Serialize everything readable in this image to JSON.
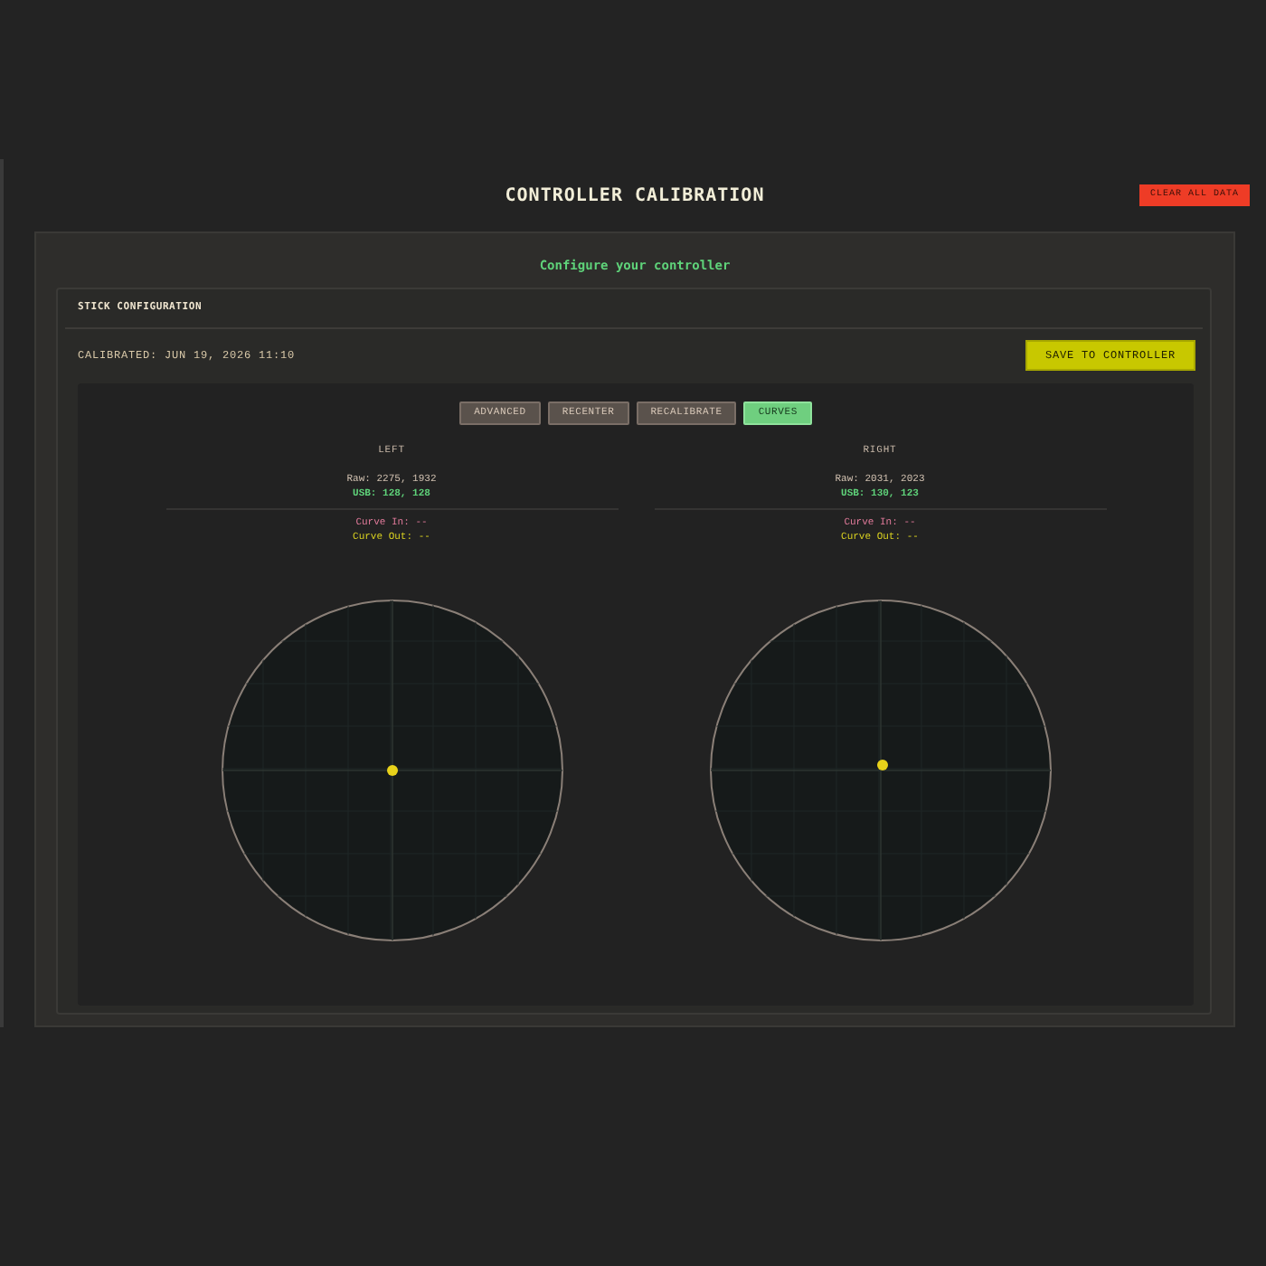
{
  "header": {
    "title": "CONTROLLER CALIBRATION",
    "clear_button": "CLEAR ALL DATA"
  },
  "card": {
    "subtitle": "Configure your controller"
  },
  "stick_panel": {
    "title": "STICK CONFIGURATION",
    "calibrated": "CALIBRATED: JUN 19, 2026 11:10",
    "save_button": "SAVE TO CONTROLLER",
    "tabs": [
      {
        "label": "ADVANCED",
        "selected": false
      },
      {
        "label": "RECENTER",
        "selected": false
      },
      {
        "label": "RECALIBRATE",
        "selected": false
      },
      {
        "label": "CURVES",
        "selected": true
      }
    ],
    "sticks": [
      {
        "label": "LEFT",
        "raw": "Raw: 2275, 1932",
        "usb": "USB: 128, 128",
        "curve_in": "Curve In: --",
        "curve_out": "Curve Out: --"
      },
      {
        "label": "RIGHT",
        "raw": "Raw: 2031, 2023",
        "usb": "USB: 130, 123",
        "curve_in": "Curve In: --",
        "curve_out": "Curve Out: --"
      }
    ]
  }
}
